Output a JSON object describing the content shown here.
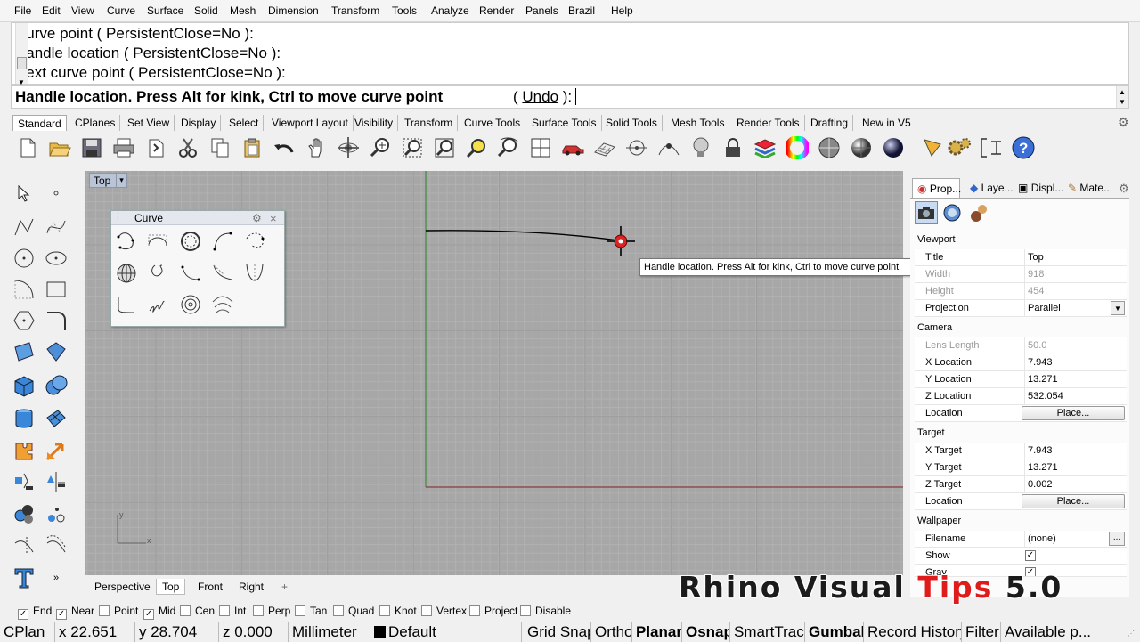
{
  "menu": [
    "File",
    "Edit",
    "View",
    "Curve",
    "Surface",
    "Solid",
    "Mesh",
    "Dimension",
    "Transform",
    "Tools",
    "Analyze",
    "Render",
    "Panels",
    "Brazil",
    "Help"
  ],
  "command_history": [
    "Curve point ( PersistentClose=No ):",
    "Handle location ( PersistentClose=No ):",
    "Next curve point ( PersistentClose=No ):"
  ],
  "command_prompt": {
    "text": "Handle location. Press Alt for kink, Ctrl to move curve point",
    "option_open": " ( ",
    "option": "Undo",
    "option_close": " ):"
  },
  "toolbar_tabs": [
    "Standard",
    "CPlanes",
    "Set View",
    "Display",
    "Select",
    "Viewport Layout",
    "Visibility",
    "Transform",
    "Curve Tools",
    "Surface Tools",
    "Solid Tools",
    "Mesh Tools",
    "Render Tools",
    "Drafting",
    "New in V5"
  ],
  "toolbar_icons": [
    "new-icon",
    "open-icon",
    "save-icon",
    "print-icon",
    "import-icon",
    "cut-icon",
    "copy-icon",
    "paste-icon",
    "undo-icon",
    "pan-icon",
    "rotate-view-icon",
    "zoom-icon",
    "zoom-window-icon",
    "zoom-extents-icon",
    "zoom-selected-icon",
    "zoom-dynamic-icon",
    "four-viewports-icon",
    "car-icon",
    "grid-icon",
    "snap-icon",
    "point-icon",
    "light-icon",
    "lock-icon",
    "layer-icon",
    "color-wheel-icon",
    "shade-icon",
    "render-sphere-icon",
    "material-sphere-icon",
    "pen-icon",
    "settings-gear-icon",
    "dimension-icon",
    "help-icon"
  ],
  "viewport": {
    "title": "Top",
    "dropdown": "▾",
    "axis_x": "x",
    "axis_y": "y"
  },
  "curve_panel": {
    "title": "Curve",
    "close": "×"
  },
  "tooltip": "Handle location. Press Alt for kink, Ctrl to move curve point",
  "viewport_tabs": [
    "Perspective",
    "Top",
    "Front",
    "Right",
    "+"
  ],
  "right_tabs": [
    "Prop...",
    "Laye...",
    "Displ...",
    "Mate..."
  ],
  "properties": {
    "viewport_section": "Viewport",
    "title_label": "Title",
    "title_value": "Top",
    "width_label": "Width",
    "width_value": "918",
    "height_label": "Height",
    "height_value": "454",
    "projection_label": "Projection",
    "projection_value": "Parallel",
    "camera_section": "Camera",
    "lens_label": "Lens Length",
    "lens_value": "50.0",
    "xloc_label": "X Location",
    "xloc_value": "7.943",
    "yloc_label": "Y Location",
    "yloc_value": "13.271",
    "zloc_label": "Z Location",
    "zloc_value": "532.054",
    "location_label": "Location",
    "place_button": "Place...",
    "target_section": "Target",
    "xtarget_label": "X Target",
    "xtarget_value": "7.943",
    "ytarget_label": "Y Target",
    "ytarget_value": "13.271",
    "ztarget_label": "Z Target",
    "ztarget_value": "0.002",
    "tlocation_label": "Location",
    "tplace_button": "Place...",
    "wallpaper_section": "Wallpaper",
    "filename_label": "Filename",
    "filename_value": "(none)",
    "browse_button": "...",
    "show_label": "Show",
    "gray_label": "Gray"
  },
  "osnaps": [
    {
      "label": "End",
      "checked": true
    },
    {
      "label": "Near",
      "checked": true
    },
    {
      "label": "Point",
      "checked": false
    },
    {
      "label": "Mid",
      "checked": true
    },
    {
      "label": "Cen",
      "checked": false
    },
    {
      "label": "Int",
      "checked": false
    },
    {
      "label": "Perp",
      "checked": false
    },
    {
      "label": "Tan",
      "checked": false
    },
    {
      "label": "Quad",
      "checked": false
    },
    {
      "label": "Knot",
      "checked": false
    },
    {
      "label": "Vertex",
      "checked": false
    },
    {
      "label": "Project",
      "checked": false
    },
    {
      "label": "Disable",
      "checked": false
    }
  ],
  "status": {
    "cplane": "CPlan",
    "x": "x 22.651",
    "y": "y 28.704",
    "z": "z 0.000",
    "units": "Millimeter",
    "layer": "Default",
    "grid_snap": "Grid Snap",
    "ortho": "Ortho",
    "planar": "Planar",
    "osnap": "Osnap",
    "smarttrack": "SmartTrack",
    "gumball": "Gumball",
    "record_history": "Record History",
    "filter": "Filter",
    "available": "Available p..."
  },
  "watermark": {
    "part1": "Rhino Visual ",
    "part2": "Tips",
    "part3": " 5.0"
  },
  "colors": {
    "viewport_bg": "#a7a7a7",
    "watermark_accent": "#e01b1b",
    "tab_highlight": "#b9c4d6"
  }
}
